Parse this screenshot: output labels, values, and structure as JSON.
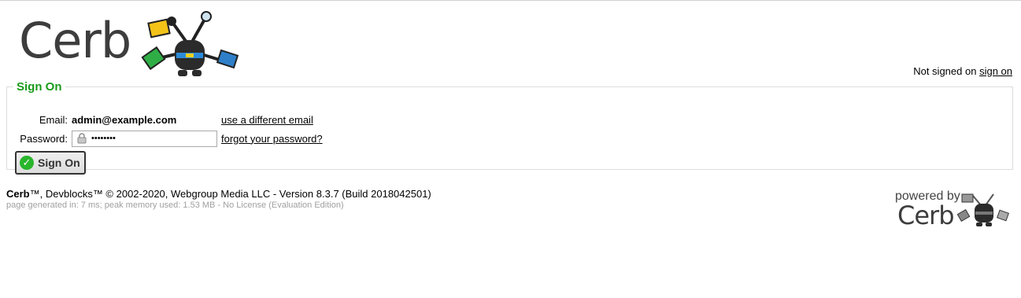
{
  "logo": {
    "word": "Cerb"
  },
  "status": {
    "prefix": "Not signed on",
    "link": "sign on"
  },
  "signon": {
    "legend": "Sign On",
    "email_label": "Email:",
    "email_value": "admin@example.com",
    "different_email_link": "use a different email",
    "password_label": "Password:",
    "password_value": "••••••••",
    "forgot_link": "forgot your password?",
    "button_label": "Sign On"
  },
  "footer": {
    "brand": "Cerb",
    "line1_rest": "™, Devblocks™ © 2002-2020, Webgroup Media LLC - Version 8.3.7 (Build 2018042501)",
    "line2": "page generated in: 7 ms; peak memory used: 1.53 MB - No License (Evaluation Edition)",
    "powered_by": "powered by",
    "powered_word": "Cerb"
  },
  "colors": {
    "accent_green": "#1a9a1a",
    "check_green": "#29b62b"
  }
}
